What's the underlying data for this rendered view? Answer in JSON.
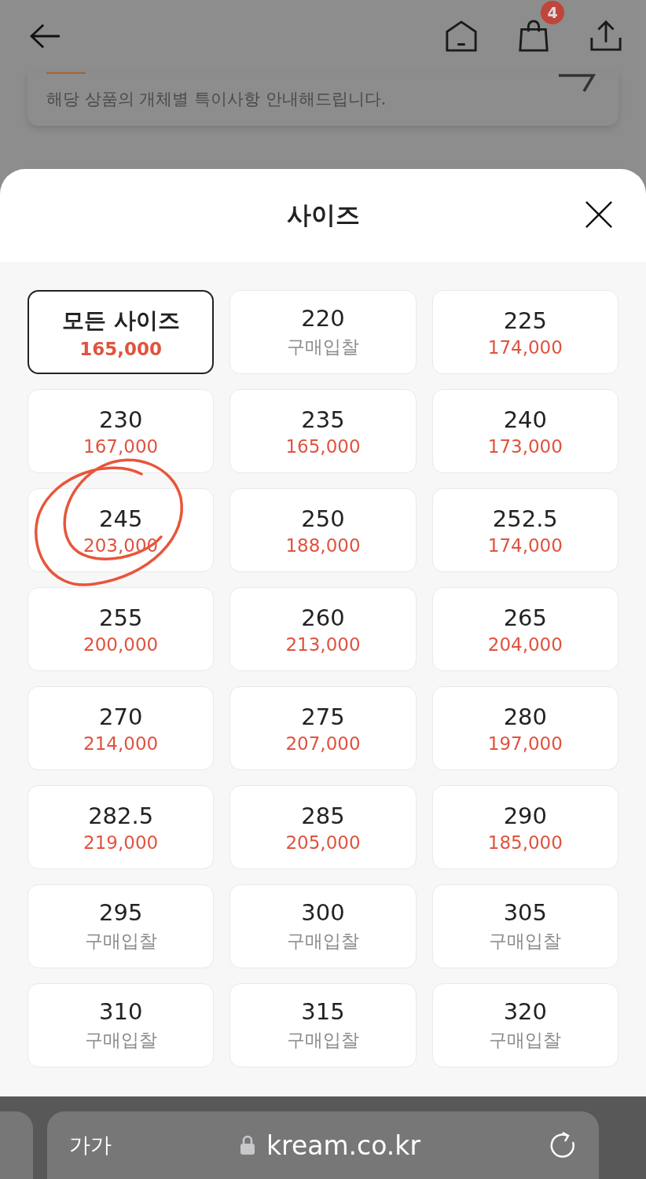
{
  "top_bar": {
    "cart_count": "4"
  },
  "notice": {
    "text": "해당 상품의 개체별 특이사항 안내해드립니다."
  },
  "sheet": {
    "title": "사이즈"
  },
  "sizes": [
    {
      "label": "모든 사이즈",
      "price": "165,000",
      "kind": "price",
      "selected": true
    },
    {
      "label": "220",
      "price": "구매입찰",
      "kind": "bid",
      "selected": false
    },
    {
      "label": "225",
      "price": "174,000",
      "kind": "price",
      "selected": false
    },
    {
      "label": "230",
      "price": "167,000",
      "kind": "price",
      "selected": false
    },
    {
      "label": "235",
      "price": "165,000",
      "kind": "price",
      "selected": false
    },
    {
      "label": "240",
      "price": "173,000",
      "kind": "price",
      "selected": false
    },
    {
      "label": "245",
      "price": "203,000",
      "kind": "price",
      "selected": false
    },
    {
      "label": "250",
      "price": "188,000",
      "kind": "price",
      "selected": false
    },
    {
      "label": "252.5",
      "price": "174,000",
      "kind": "price",
      "selected": false
    },
    {
      "label": "255",
      "price": "200,000",
      "kind": "price",
      "selected": false
    },
    {
      "label": "260",
      "price": "213,000",
      "kind": "price",
      "selected": false
    },
    {
      "label": "265",
      "price": "204,000",
      "kind": "price",
      "selected": false
    },
    {
      "label": "270",
      "price": "214,000",
      "kind": "price",
      "selected": false
    },
    {
      "label": "275",
      "price": "207,000",
      "kind": "price",
      "selected": false
    },
    {
      "label": "280",
      "price": "197,000",
      "kind": "price",
      "selected": false
    },
    {
      "label": "282.5",
      "price": "219,000",
      "kind": "price",
      "selected": false
    },
    {
      "label": "285",
      "price": "205,000",
      "kind": "price",
      "selected": false
    },
    {
      "label": "290",
      "price": "185,000",
      "kind": "price",
      "selected": false
    },
    {
      "label": "295",
      "price": "구매입찰",
      "kind": "bid",
      "selected": false
    },
    {
      "label": "300",
      "price": "구매입찰",
      "kind": "bid",
      "selected": false
    },
    {
      "label": "305",
      "price": "구매입찰",
      "kind": "bid",
      "selected": false
    },
    {
      "label": "310",
      "price": "구매입찰",
      "kind": "bid",
      "selected": false
    },
    {
      "label": "315",
      "price": "구매입찰",
      "kind": "bid",
      "selected": false
    },
    {
      "label": "320",
      "price": "구매입찰",
      "kind": "bid",
      "selected": false
    }
  ],
  "browser_bar": {
    "text_size": "가가",
    "url": "kream.co.kr"
  }
}
